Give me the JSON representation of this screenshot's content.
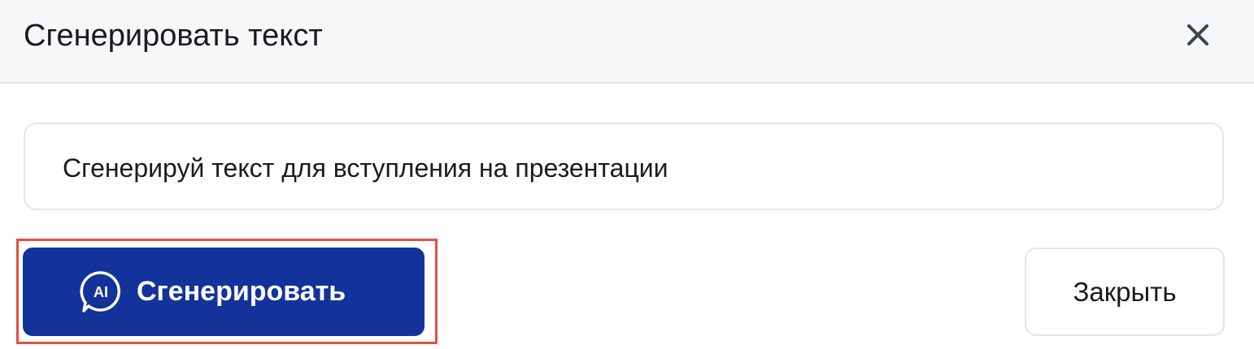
{
  "dialog": {
    "title": "Сгенерировать текст",
    "close_icon": "close-icon"
  },
  "prompt": {
    "value": "Сгенерируй текст для вступления на презентации"
  },
  "actions": {
    "generate_label": "Сгенерировать",
    "generate_icon": "ai-chat-icon",
    "ai_icon_text": "AI",
    "close_label": "Закрыть"
  },
  "colors": {
    "accent": "#13339a",
    "highlight": "#e0513f",
    "header_bg": "#f6f7f9",
    "border": "#e3e6ec"
  }
}
